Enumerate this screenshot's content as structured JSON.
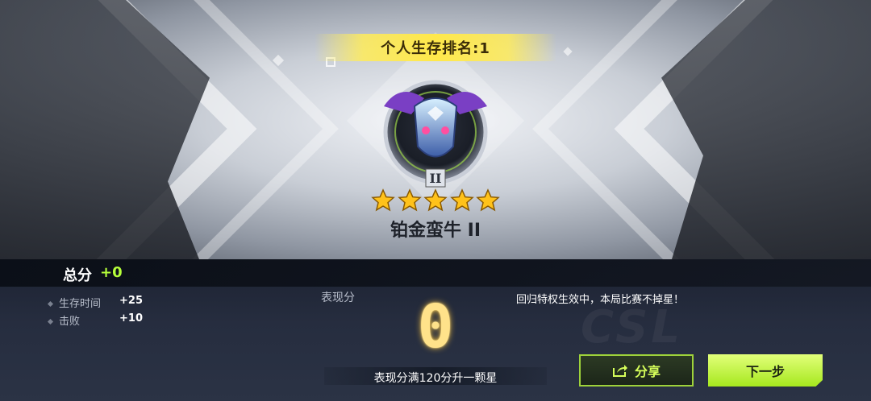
{
  "header": {
    "rank_banner": "个人生存排名:1"
  },
  "rank": {
    "tier_name": "铂金蛮牛 II",
    "badge_numeral": "II",
    "stars_filled": 5,
    "stars_total": 5,
    "badge_icon": "platinum-bull-badge-icon",
    "star_icon": "star-icon"
  },
  "summary": {
    "total_label": "总分",
    "total_value": "+0",
    "stats": [
      {
        "label": "生存时间",
        "value": "+25"
      },
      {
        "label": "击败",
        "value": "+10"
      }
    ]
  },
  "performance": {
    "label": "表现分",
    "score": "0",
    "tip": "表现分满120分升一颗星"
  },
  "notice": "回归特权生效中，本局比赛不掉星！",
  "buttons": {
    "share_label": "分享",
    "share_icon": "share-icon",
    "next_label": "下一步"
  },
  "colors": {
    "accent_green": "#b6ff3a",
    "banner_yellow": "#ffe84a",
    "score_gold": "#ffe28a"
  }
}
